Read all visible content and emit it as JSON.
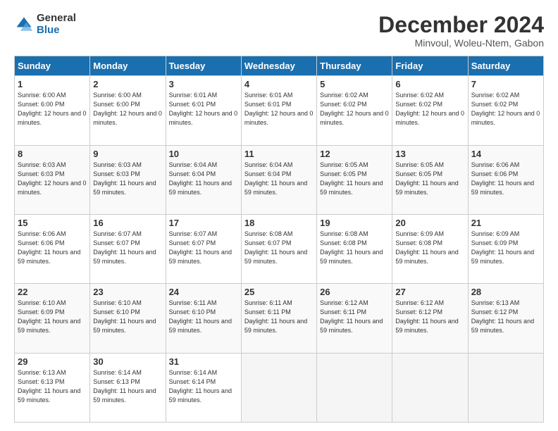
{
  "logo": {
    "general": "General",
    "blue": "Blue"
  },
  "title": "December 2024",
  "subtitle": "Minvoul, Woleu-Ntem, Gabon",
  "days_of_week": [
    "Sunday",
    "Monday",
    "Tuesday",
    "Wednesday",
    "Thursday",
    "Friday",
    "Saturday"
  ],
  "weeks": [
    [
      {
        "day": "1",
        "sunrise": "6:00 AM",
        "sunset": "6:00 PM",
        "daylight": "12 hours and 0 minutes."
      },
      {
        "day": "2",
        "sunrise": "6:00 AM",
        "sunset": "6:00 PM",
        "daylight": "12 hours and 0 minutes."
      },
      {
        "day": "3",
        "sunrise": "6:01 AM",
        "sunset": "6:01 PM",
        "daylight": "12 hours and 0 minutes."
      },
      {
        "day": "4",
        "sunrise": "6:01 AM",
        "sunset": "6:01 PM",
        "daylight": "12 hours and 0 minutes."
      },
      {
        "day": "5",
        "sunrise": "6:02 AM",
        "sunset": "6:02 PM",
        "daylight": "12 hours and 0 minutes."
      },
      {
        "day": "6",
        "sunrise": "6:02 AM",
        "sunset": "6:02 PM",
        "daylight": "12 hours and 0 minutes."
      },
      {
        "day": "7",
        "sunrise": "6:02 AM",
        "sunset": "6:02 PM",
        "daylight": "12 hours and 0 minutes."
      }
    ],
    [
      {
        "day": "8",
        "sunrise": "6:03 AM",
        "sunset": "6:03 PM",
        "daylight": "12 hours and 0 minutes."
      },
      {
        "day": "9",
        "sunrise": "6:03 AM",
        "sunset": "6:03 PM",
        "daylight": "11 hours and 59 minutes."
      },
      {
        "day": "10",
        "sunrise": "6:04 AM",
        "sunset": "6:04 PM",
        "daylight": "11 hours and 59 minutes."
      },
      {
        "day": "11",
        "sunrise": "6:04 AM",
        "sunset": "6:04 PM",
        "daylight": "11 hours and 59 minutes."
      },
      {
        "day": "12",
        "sunrise": "6:05 AM",
        "sunset": "6:05 PM",
        "daylight": "11 hours and 59 minutes."
      },
      {
        "day": "13",
        "sunrise": "6:05 AM",
        "sunset": "6:05 PM",
        "daylight": "11 hours and 59 minutes."
      },
      {
        "day": "14",
        "sunrise": "6:06 AM",
        "sunset": "6:06 PM",
        "daylight": "11 hours and 59 minutes."
      }
    ],
    [
      {
        "day": "15",
        "sunrise": "6:06 AM",
        "sunset": "6:06 PM",
        "daylight": "11 hours and 59 minutes."
      },
      {
        "day": "16",
        "sunrise": "6:07 AM",
        "sunset": "6:07 PM",
        "daylight": "11 hours and 59 minutes."
      },
      {
        "day": "17",
        "sunrise": "6:07 AM",
        "sunset": "6:07 PM",
        "daylight": "11 hours and 59 minutes."
      },
      {
        "day": "18",
        "sunrise": "6:08 AM",
        "sunset": "6:07 PM",
        "daylight": "11 hours and 59 minutes."
      },
      {
        "day": "19",
        "sunrise": "6:08 AM",
        "sunset": "6:08 PM",
        "daylight": "11 hours and 59 minutes."
      },
      {
        "day": "20",
        "sunrise": "6:09 AM",
        "sunset": "6:08 PM",
        "daylight": "11 hours and 59 minutes."
      },
      {
        "day": "21",
        "sunrise": "6:09 AM",
        "sunset": "6:09 PM",
        "daylight": "11 hours and 59 minutes."
      }
    ],
    [
      {
        "day": "22",
        "sunrise": "6:10 AM",
        "sunset": "6:09 PM",
        "daylight": "11 hours and 59 minutes."
      },
      {
        "day": "23",
        "sunrise": "6:10 AM",
        "sunset": "6:10 PM",
        "daylight": "11 hours and 59 minutes."
      },
      {
        "day": "24",
        "sunrise": "6:11 AM",
        "sunset": "6:10 PM",
        "daylight": "11 hours and 59 minutes."
      },
      {
        "day": "25",
        "sunrise": "6:11 AM",
        "sunset": "6:11 PM",
        "daylight": "11 hours and 59 minutes."
      },
      {
        "day": "26",
        "sunrise": "6:12 AM",
        "sunset": "6:11 PM",
        "daylight": "11 hours and 59 minutes."
      },
      {
        "day": "27",
        "sunrise": "6:12 AM",
        "sunset": "6:12 PM",
        "daylight": "11 hours and 59 minutes."
      },
      {
        "day": "28",
        "sunrise": "6:13 AM",
        "sunset": "6:12 PM",
        "daylight": "11 hours and 59 minutes."
      }
    ],
    [
      {
        "day": "29",
        "sunrise": "6:13 AM",
        "sunset": "6:13 PM",
        "daylight": "11 hours and 59 minutes."
      },
      {
        "day": "30",
        "sunrise": "6:14 AM",
        "sunset": "6:13 PM",
        "daylight": "11 hours and 59 minutes."
      },
      {
        "day": "31",
        "sunrise": "6:14 AM",
        "sunset": "6:14 PM",
        "daylight": "11 hours and 59 minutes."
      },
      null,
      null,
      null,
      null
    ]
  ]
}
